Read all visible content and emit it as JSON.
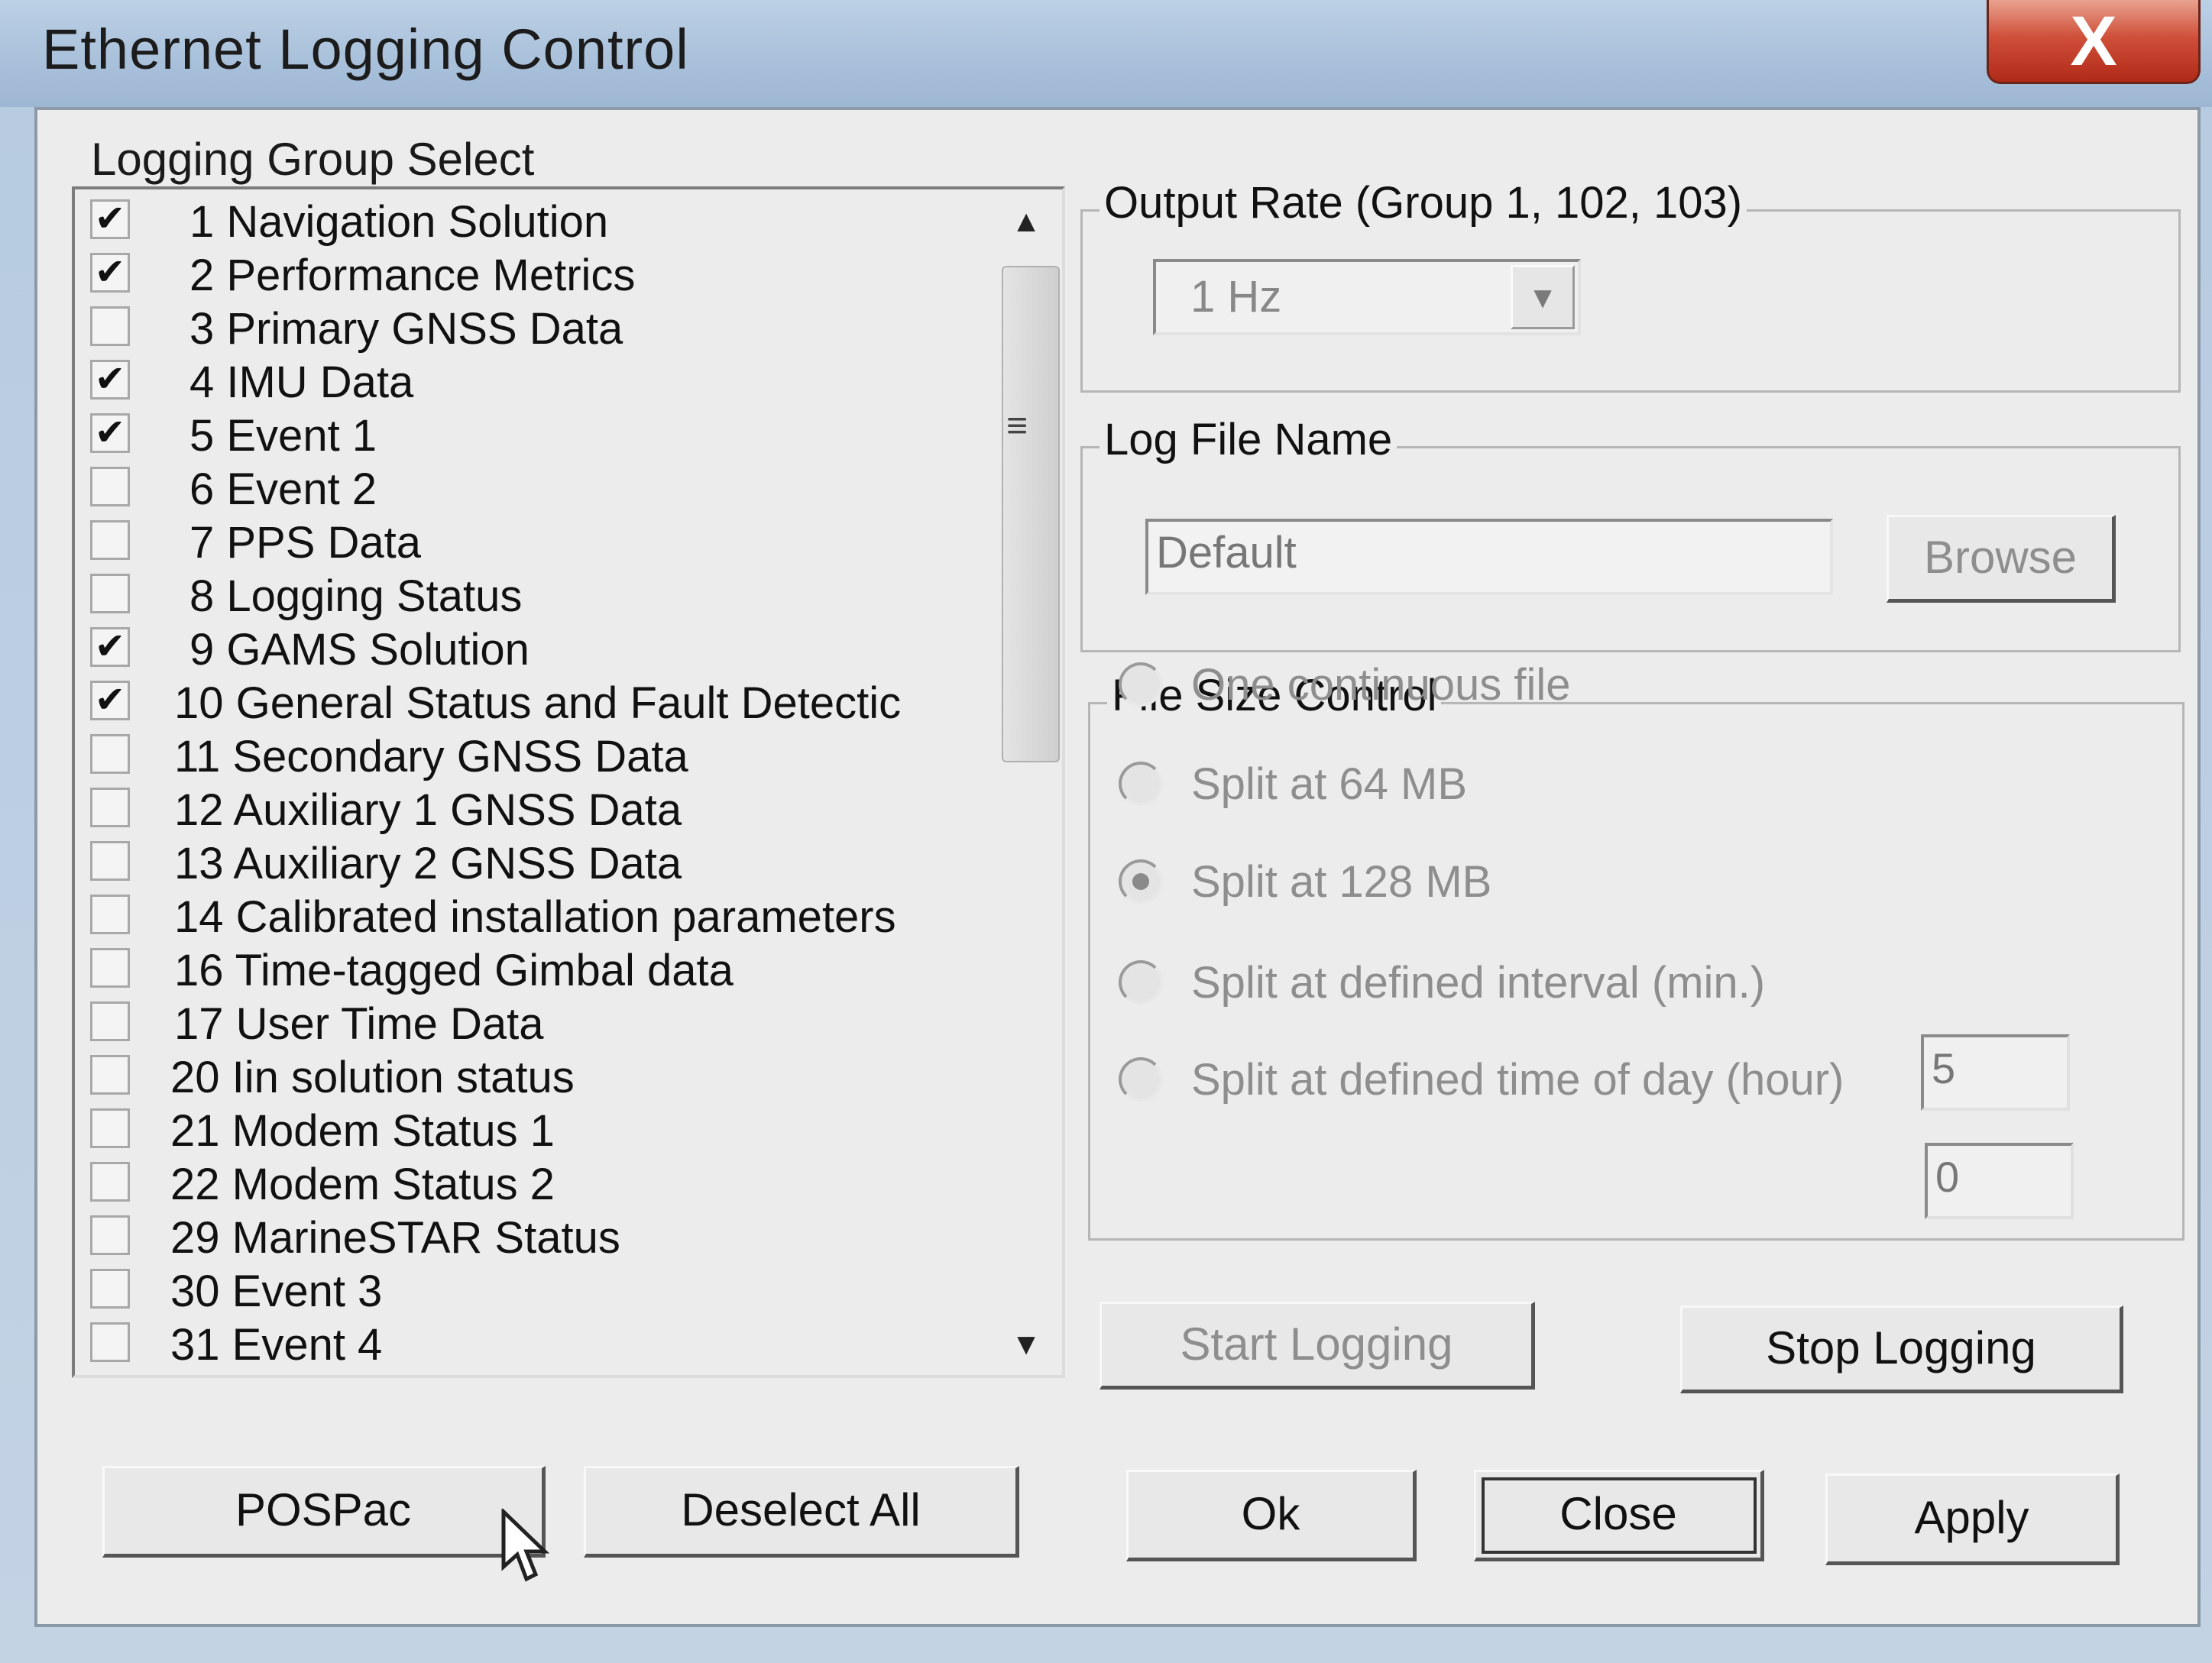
{
  "window": {
    "title": "Ethernet Logging Control",
    "close_glyph": "X"
  },
  "logging_group": {
    "label": "Logging Group Select",
    "items": [
      {
        "label": "1 Navigation Solution",
        "checked": true
      },
      {
        "label": "2 Performance Metrics",
        "checked": true
      },
      {
        "label": "3 Primary GNSS Data",
        "checked": false
      },
      {
        "label": "4 IMU Data",
        "checked": true
      },
      {
        "label": "5 Event 1",
        "checked": true
      },
      {
        "label": "6 Event 2",
        "checked": false
      },
      {
        "label": "7 PPS Data",
        "checked": false
      },
      {
        "label": "8 Logging Status",
        "checked": false
      },
      {
        "label": "9 GAMS Solution",
        "checked": true
      },
      {
        "label": "10 General Status and Fault Detectic",
        "checked": true
      },
      {
        "label": "11 Secondary GNSS Data",
        "checked": false
      },
      {
        "label": "12 Auxiliary 1 GNSS Data",
        "checked": false
      },
      {
        "label": "13 Auxiliary 2 GNSS Data",
        "checked": false
      },
      {
        "label": "14 Calibrated installation parameters",
        "checked": false
      },
      {
        "label": "16 Time-tagged Gimbal data",
        "checked": false
      },
      {
        "label": "17 User Time Data",
        "checked": false
      },
      {
        "label": "20 Iin solution status",
        "checked": false
      },
      {
        "label": "21 Modem Status 1",
        "checked": false
      },
      {
        "label": "22 Modem Status 2",
        "checked": false
      },
      {
        "label": "29 MarineSTAR Status",
        "checked": false
      },
      {
        "label": "30 Event 3",
        "checked": false
      },
      {
        "label": "31 Event 4",
        "checked": false
      }
    ],
    "check_glyph": "✔"
  },
  "output_rate": {
    "label": "Output Rate (Group 1, 102, 103)",
    "value": "1 Hz"
  },
  "log_file": {
    "label": "Log File Name",
    "value": "Default",
    "browse_label": "Browse"
  },
  "file_size": {
    "label": "File Size Control",
    "options": [
      {
        "label": "One continuous file",
        "selected": false
      },
      {
        "label": "Split at 64 MB",
        "selected": false
      },
      {
        "label": "Split at 128 MB",
        "selected": true
      },
      {
        "label": "Split at defined interval (min.)",
        "selected": false
      },
      {
        "label": "Split at defined time of day (hour)",
        "selected": false
      }
    ],
    "interval_value": "5",
    "time_of_day_value": "0"
  },
  "buttons": {
    "start_logging": "Start Logging",
    "stop_logging": "Stop Logging",
    "pospac": "POSPac",
    "deselect_all": "Deselect All",
    "ok": "Ok",
    "close": "Close",
    "apply": "Apply"
  }
}
